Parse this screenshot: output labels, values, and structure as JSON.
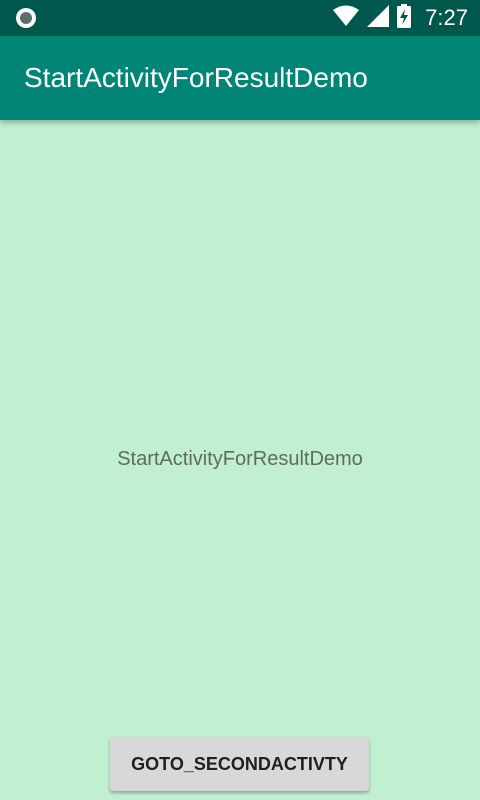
{
  "status_bar": {
    "time": "7:27",
    "icons": [
      "notification-circle-icon",
      "wifi-icon",
      "cell-signal-icon",
      "battery-charging-icon"
    ],
    "background": "#00574b"
  },
  "app_bar": {
    "title": "StartActivityForResultDemo",
    "background": "#008577"
  },
  "main": {
    "background": "#c0f0d0",
    "center_text": "StartActivityForResultDemo",
    "button_label": "GOTO_SECONDACTIVTY"
  }
}
